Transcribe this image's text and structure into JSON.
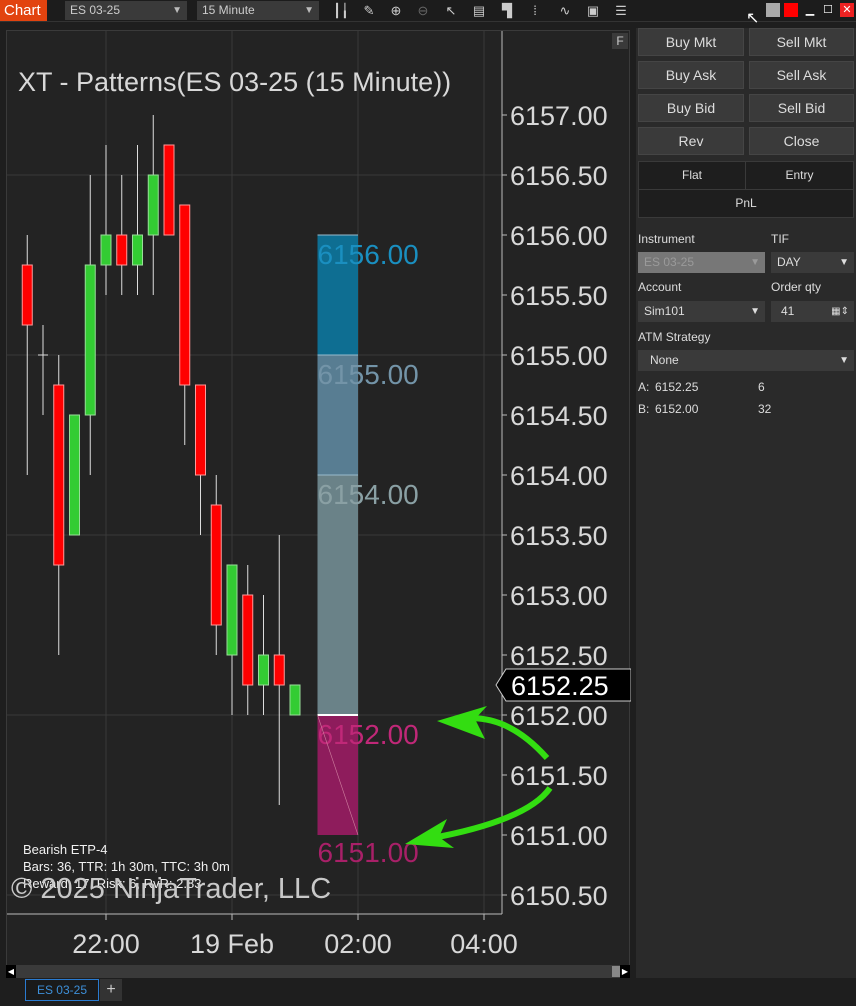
{
  "topbar": {
    "chart_tab": "Chart",
    "instrument": "ES 03-25",
    "interval": "15 Minute",
    "tools": [
      "bar-chart-icon",
      "pencil-icon",
      "zoom-in-icon",
      "zoom-out-icon",
      "pointer-icon",
      "data-box-icon",
      "chart-trader-icon",
      "volume-icon",
      "strategy-icon",
      "properties-icon",
      "list-icon"
    ]
  },
  "chart": {
    "title": "XT - Patterns(ES 03-25 (15 Minute))",
    "f_label": "F",
    "info_lines": [
      "Bearish ETP-4",
      "Bars: 36, TTR: 1h 30m, TTC: 3h 0m",
      "Reward: 17, Risk: 6, RvR: 2.83"
    ],
    "watermark": "© 2025 NinjaTrader, LLC",
    "last_price": "6152.25"
  },
  "chart_data": {
    "type": "candlestick",
    "ylim": [
      6150.5,
      6157.25
    ],
    "y_ticks": [
      "6157.00",
      "6156.50",
      "6156.00",
      "6155.50",
      "6155.00",
      "6154.50",
      "6154.00",
      "6153.50",
      "6153.00",
      "6152.50",
      "6152.00",
      "6151.50",
      "6151.00",
      "6150.50"
    ],
    "x_ticks": [
      {
        "label": "22:00",
        "time": "22:00"
      },
      {
        "label": "19 Feb",
        "time": "00:00"
      },
      {
        "label": "02:00",
        "time": "02:00"
      },
      {
        "label": "04:00",
        "time": "04:00"
      }
    ],
    "candles": [
      {
        "t": "20:45",
        "o": 6155.75,
        "h": 6156.0,
        "l": 6154.0,
        "c": 6155.25
      },
      {
        "t": "21:00",
        "o": 6155.0,
        "h": 6155.25,
        "l": 6154.5,
        "c": 6155.0
      },
      {
        "t": "21:15",
        "o": 6154.75,
        "h": 6155.0,
        "l": 6152.5,
        "c": 6153.25
      },
      {
        "t": "21:30",
        "o": 6153.5,
        "h": 6154.5,
        "l": 6153.5,
        "c": 6154.5
      },
      {
        "t": "21:45",
        "o": 6154.5,
        "h": 6156.5,
        "l": 6154.0,
        "c": 6155.75
      },
      {
        "t": "22:00",
        "o": 6155.75,
        "h": 6156.75,
        "l": 6155.5,
        "c": 6156.0
      },
      {
        "t": "22:15",
        "o": 6156.0,
        "h": 6156.5,
        "l": 6155.5,
        "c": 6155.75
      },
      {
        "t": "22:30",
        "o": 6155.75,
        "h": 6156.75,
        "l": 6155.5,
        "c": 6156.0
      },
      {
        "t": "22:45",
        "o": 6156.0,
        "h": 6157.0,
        "l": 6155.5,
        "c": 6156.5
      },
      {
        "t": "23:00",
        "o": 6156.75,
        "h": 6156.75,
        "l": 6156.0,
        "c": 6156.0
      },
      {
        "t": "23:15",
        "o": 6156.25,
        "h": 6156.25,
        "l": 6154.25,
        "c": 6154.75
      },
      {
        "t": "23:30",
        "o": 6154.75,
        "h": 6154.75,
        "l": 6153.5,
        "c": 6154.0
      },
      {
        "t": "23:45",
        "o": 6153.75,
        "h": 6154.0,
        "l": 6152.5,
        "c": 6152.75
      },
      {
        "t": "00:00",
        "o": 6152.5,
        "h": 6153.25,
        "l": 6152.0,
        "c": 6153.25
      },
      {
        "t": "00:15",
        "o": 6153.0,
        "h": 6153.25,
        "l": 6152.0,
        "c": 6152.25
      },
      {
        "t": "00:30",
        "o": 6152.25,
        "h": 6153.0,
        "l": 6152.0,
        "c": 6152.5
      },
      {
        "t": "00:45",
        "o": 6152.5,
        "h": 6153.5,
        "l": 6151.25,
        "c": 6152.25
      },
      {
        "t": "01:00",
        "o": 6152.0,
        "h": 6152.25,
        "l": 6152.0,
        "c": 6152.25
      }
    ],
    "target_zones": [
      {
        "from": 6156.0,
        "to": 6155.0,
        "label": "6156.00",
        "color": "#0e6e92",
        "text_color": "#1a8fc0"
      },
      {
        "from": 6155.0,
        "to": 6154.0,
        "label": "6155.00",
        "color": "#587d92",
        "text_color": "#7394a8"
      },
      {
        "from": 6154.0,
        "to": 6152.0,
        "label": "6154.00",
        "color": "#6a8288",
        "text_color": "#8aa0a4"
      },
      {
        "from": 6152.0,
        "to": 6151.0,
        "label": "6152.00",
        "color": "#8e1c5c",
        "text_color": "#c02878"
      }
    ],
    "stop_label": "6151.00",
    "zone_start": "01:30",
    "zone_end": "02:00",
    "colors": {
      "up": "#33cc33",
      "down": "#ff0000",
      "background": "#232323",
      "arrows": "#33dd11"
    }
  },
  "panel": {
    "buttons": [
      [
        "Buy Mkt",
        "Sell Mkt"
      ],
      [
        "Buy Ask",
        "Sell Ask"
      ],
      [
        "Buy Bid",
        "Sell Bid"
      ],
      [
        "Rev",
        "Close"
      ]
    ],
    "flat": "Flat",
    "entry": "Entry",
    "pnl": "PnL",
    "instrument_label": "Instrument",
    "instrument_value": "ES 03-25",
    "tif_label": "TIF",
    "tif_value": "DAY",
    "account_label": "Account",
    "account_value": "Sim101",
    "qty_label": "Order qty",
    "qty_value": "41",
    "atm_label": "ATM Strategy",
    "atm_value": "None",
    "ask": {
      "label": "A:",
      "price": "6152.25",
      "size": "6"
    },
    "bid": {
      "label": "B:",
      "price": "6152.00",
      "size": "32"
    }
  },
  "bottom_tabs": {
    "tab": "ES 03-25",
    "add": "+"
  }
}
